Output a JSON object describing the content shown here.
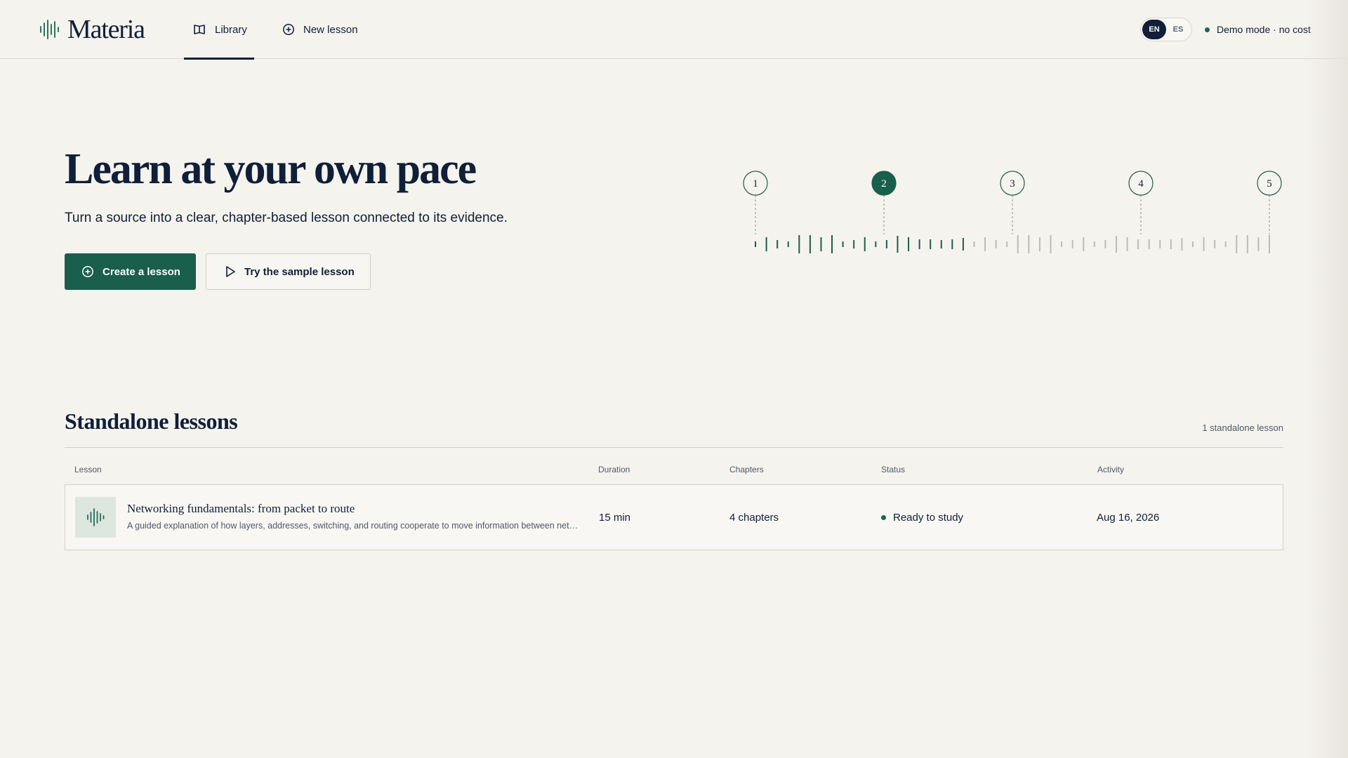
{
  "app": {
    "name": "Materia",
    "nav": {
      "library_label": "Library",
      "new_lesson_label": "New lesson"
    },
    "languages": [
      {
        "code": "EN",
        "active": true
      },
      {
        "code": "ES",
        "active": false
      }
    ],
    "demo_mode_text": "Demo mode · no cost"
  },
  "hero": {
    "title": "Learn at your own pace",
    "subtitle": "Turn a source into a clear, chapter-based lesson connected to its evidence.",
    "primary_button": "Create a lesson",
    "secondary_button": "Try the sample lesson",
    "timeline": {
      "steps": [
        "1",
        "2",
        "3",
        "4",
        "5"
      ],
      "active_step": 2
    }
  },
  "standalone": {
    "title": "Standalone lessons",
    "count_text": "1 standalone lesson",
    "columns": {
      "lesson": "Lesson",
      "duration": "Duration",
      "chapters": "Chapters",
      "status": "Status",
      "activity": "Activity"
    },
    "rows": [
      {
        "title": "Networking fundamentals: from packet to route",
        "description": "A guided explanation of how layers, addresses, switching, and routing cooperate to move information between networks.",
        "duration": "15 min",
        "chapters": "4 chapters",
        "status": "Ready to study",
        "activity": "Aug 16, 2026"
      }
    ]
  },
  "colors": {
    "accent": "#1a5e4c",
    "ink": "#0f1f38",
    "background": "#f5f3ee",
    "muted_tick": "#b8bdb6"
  },
  "icons": {
    "logo": "waveform-icon",
    "library": "book-open-icon",
    "new_lesson": "plus-circle-icon",
    "create": "plus-circle-icon",
    "sample": "play-icon",
    "thumb": "waveform-icon"
  }
}
